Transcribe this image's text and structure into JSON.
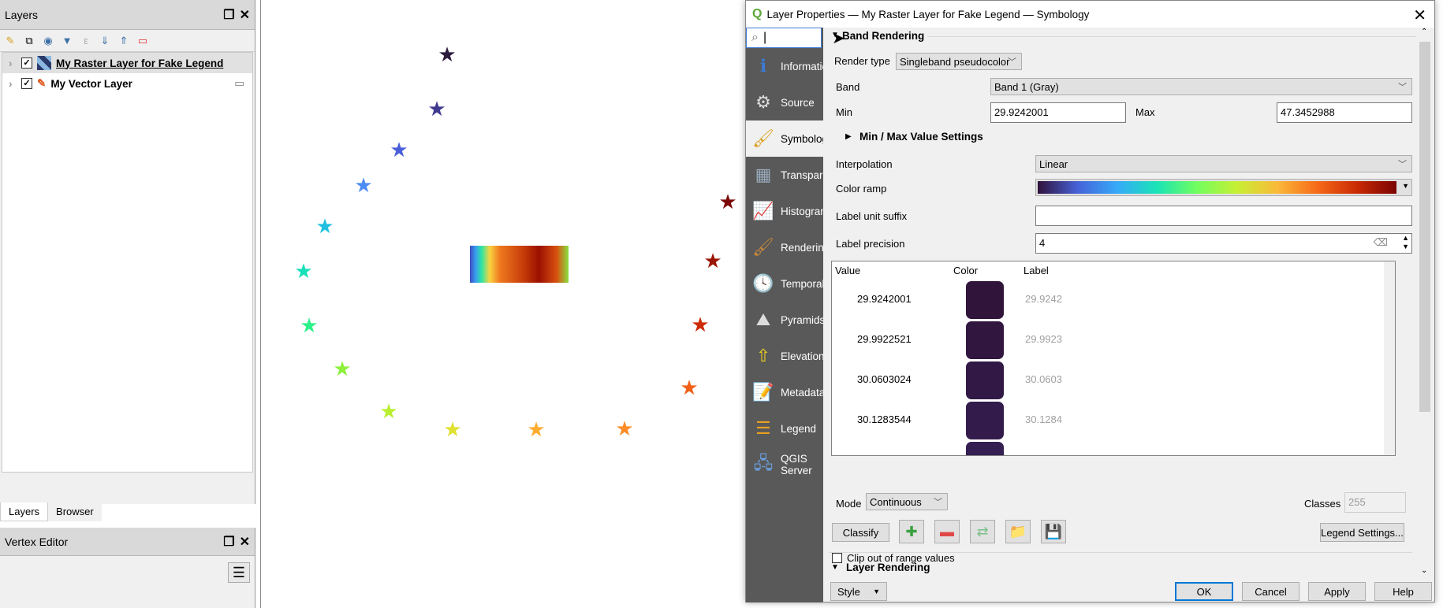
{
  "layers_panel": {
    "title": "Layers",
    "items": [
      {
        "name": "My Raster Layer for Fake Legend",
        "checked": true,
        "selected": true
      },
      {
        "name": "My Vector Layer",
        "checked": true,
        "selected": false
      }
    ],
    "tabs": [
      "Layers",
      "Browser"
    ]
  },
  "vertex_editor": {
    "title": "Vertex Editor"
  },
  "map": {
    "stars": [
      "#2d1b3d",
      "#3f3a8f",
      "#4a5ed8",
      "#4b8cf5",
      "#22c0e0",
      "#18e0b8",
      "#2ef08a",
      "#8cf03a",
      "#b8f030",
      "#e0e030",
      "#ffab30",
      "#ff8c28",
      "#f26018",
      "#cc2a08",
      "#9a1404",
      "#7a0606"
    ]
  },
  "dialog": {
    "title": "Layer Properties — My Raster Layer for Fake Legend — Symbology",
    "search": {
      "value": ""
    },
    "sidebar": [
      {
        "label": "Information",
        "icon": "info-icon"
      },
      {
        "label": "Source",
        "icon": "source-icon"
      },
      {
        "label": "Symbology",
        "icon": "symbology-icon",
        "active": true
      },
      {
        "label": "Transparency",
        "icon": "transparency-icon"
      },
      {
        "label": "Histogram",
        "icon": "histogram-icon"
      },
      {
        "label": "Rendering",
        "icon": "rendering-icon"
      },
      {
        "label": "Temporal",
        "icon": "temporal-icon"
      },
      {
        "label": "Pyramids",
        "icon": "pyramids-icon"
      },
      {
        "label": "Elevation",
        "icon": "elevation-icon"
      },
      {
        "label": "Metadata",
        "icon": "metadata-icon"
      },
      {
        "label": "Legend",
        "icon": "legend-icon"
      },
      {
        "label": "QGIS Server",
        "icon": "server-icon"
      }
    ],
    "band_rendering": {
      "title": "Band Rendering",
      "render_type_label": "Render type",
      "render_type": "Singleband pseudocolor",
      "band_label": "Band",
      "band": "Band 1 (Gray)",
      "min_label": "Min",
      "min": "29.9242001",
      "max_label": "Max",
      "max": "47.3452988",
      "minmax_settings": "Min / Max Value Settings",
      "interpolation_label": "Interpolation",
      "interpolation": "Linear",
      "color_ramp_label": "Color ramp",
      "label_unit_suffix_label": "Label unit suffix",
      "label_unit_suffix": "",
      "label_precision_label": "Label precision",
      "label_precision": "4",
      "table": {
        "headers": [
          "Value",
          "Color",
          "Label"
        ],
        "rows": [
          {
            "value": "29.9242001",
            "color": "#30143a",
            "label": "29.9242"
          },
          {
            "value": "29.9922521",
            "color": "#31163f",
            "label": "29.9923"
          },
          {
            "value": "30.0603024",
            "color": "#321945",
            "label": "30.0603"
          },
          {
            "value": "30.1283544",
            "color": "#331b4c",
            "label": "30.1284"
          },
          {
            "value": "",
            "color": "#341e52",
            "label": ""
          }
        ]
      },
      "mode_label": "Mode",
      "mode": "Continuous",
      "classes_label": "Classes",
      "classes": "255",
      "classify": "Classify",
      "legend_settings": "Legend Settings...",
      "clip_label": "Clip out of range values",
      "clip_checked": false
    },
    "layer_rendering_title": "Layer Rendering",
    "footer": {
      "style": "Style",
      "ok": "OK",
      "cancel": "Cancel",
      "apply": "Apply",
      "help": "Help"
    }
  }
}
